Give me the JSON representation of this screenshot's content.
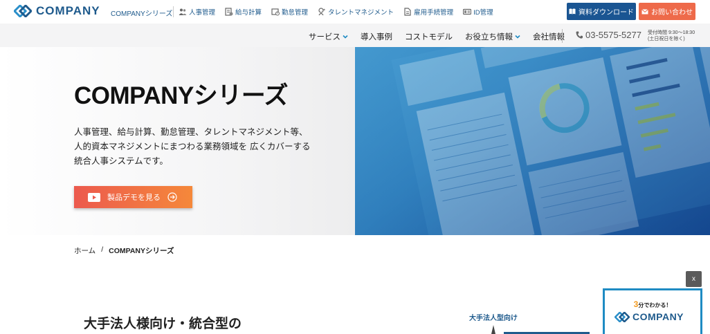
{
  "header": {
    "logo_text": "COMPANY",
    "series_link": "COMPANYシリーズ",
    "nav": [
      {
        "label": "人事管理",
        "icon": "people-icon"
      },
      {
        "label": "給与計算",
        "icon": "payroll-icon"
      },
      {
        "label": "勤怠管理",
        "icon": "attendance-icon"
      },
      {
        "label": "タレントマネジメント",
        "icon": "talent-icon"
      },
      {
        "label": "雇用手続管理",
        "icon": "document-icon"
      },
      {
        "label": "ID管理",
        "icon": "id-card-icon"
      }
    ],
    "download_label": "資料ダウンロード",
    "contact_label": "お問い合わせ"
  },
  "navbar": {
    "items": [
      {
        "label": "サービス",
        "has_dropdown": true
      },
      {
        "label": "導入事例",
        "has_dropdown": false
      },
      {
        "label": "コストモデル",
        "has_dropdown": false
      },
      {
        "label": "お役立ち情報",
        "has_dropdown": true
      },
      {
        "label": "会社情報",
        "has_dropdown": false
      }
    ],
    "phone": "03-5575-5277",
    "hours_line1": "受付時間 9:30～18:30",
    "hours_line2": "(土日祝日を除く)"
  },
  "hero": {
    "title": "COMPANYシリーズ",
    "description": [
      "人事管理、給与計算、勤怠管理、タレントマネジメント等、",
      "人的資本マネジメントにまつわる業務領域を 広くカバーする",
      "統合人事システムです。"
    ],
    "demo_button": "製品デモを見る"
  },
  "breadcrumb": {
    "home": "ホーム",
    "separator": "/",
    "current": "COMPANYシリーズ"
  },
  "content": {
    "heading": "大手法人様向け・統合型の",
    "side_label": "大手法人型向け"
  },
  "promo": {
    "close_label": "x",
    "number": "3",
    "tagline_rest": "分でわかる！",
    "logo_text": "COMPANY"
  },
  "colors": {
    "brand_blue": "#1e5a8c",
    "download_button": "#1a5592",
    "contact_button": "#ee6a4a",
    "demo_gradient_start": "#ec5a4e",
    "demo_gradient_end": "#f5883a",
    "promo_accent": "#f29a1f"
  }
}
